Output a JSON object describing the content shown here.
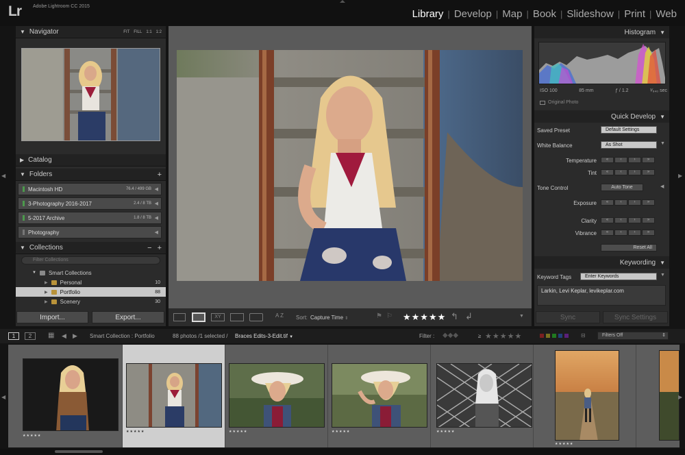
{
  "app": {
    "logo": "Lr",
    "title": "Adobe Lightroom CC 2015"
  },
  "modules": [
    {
      "label": "Library",
      "active": true
    },
    {
      "label": "Develop"
    },
    {
      "label": "Map"
    },
    {
      "label": "Book"
    },
    {
      "label": "Slideshow"
    },
    {
      "label": "Print"
    },
    {
      "label": "Web"
    }
  ],
  "navigator": {
    "title": "Navigator",
    "opts": [
      "FIT",
      "FILL",
      "1:1",
      "1:2"
    ]
  },
  "catalog": {
    "title": "Catalog"
  },
  "folders": {
    "title": "Folders",
    "add": "+",
    "volumes": [
      {
        "name": "Macintosh HD",
        "size": "76.4 / 499 GB"
      },
      {
        "name": "3-Photography 2016-2017",
        "size": "2.4 / 8 TB"
      },
      {
        "name": "5-2017 Archive",
        "size": "1.8 / 8 TB"
      },
      {
        "name": "Photography",
        "size": ""
      }
    ]
  },
  "collections": {
    "title": "Collections",
    "minus": "−",
    "plus": "+",
    "filter_placeholder": "Filter Collections",
    "smart": "Smart Collections",
    "items": [
      {
        "name": "Personal",
        "count": "10"
      },
      {
        "name": "Portfolio",
        "count": "88",
        "selected": true
      },
      {
        "name": "Scenery",
        "count": "30"
      }
    ]
  },
  "left_buttons": {
    "import": "Import...",
    "export": "Export..."
  },
  "toolbar": {
    "sort_label": "Sort:",
    "sort_value": "Capture Time",
    "rating": "★★★★★",
    "az": "A Z"
  },
  "histogram": {
    "title": "Histogram",
    "iso": "ISO 100",
    "focal": "85 mm",
    "aperture": "ƒ / 1.2",
    "shutter": "¹⁄₆₄₀ sec",
    "original": "Original Photo"
  },
  "quick_develop": {
    "title": "Quick Develop",
    "saved_preset_label": "Saved Preset",
    "saved_preset": "Default Settings",
    "wb_label": "White Balance",
    "wb": "As Shot",
    "temperature": "Temperature",
    "tint": "Tint",
    "tone_label": "Tone Control",
    "auto_tone": "Auto Tone",
    "exposure": "Exposure",
    "clarity": "Clarity",
    "vibrance": "Vibrance",
    "reset": "Reset All"
  },
  "keywording": {
    "title": "Keywording",
    "tags_label": "Keyword Tags",
    "tags_value": "Enter Keywords",
    "keywords": "Larkin, Levi Keplar, levikeplar.com"
  },
  "sync": {
    "sync": "Sync",
    "sync_settings": "Sync Settings"
  },
  "filmstrip_bar": {
    "view1": "1",
    "view2": "2",
    "source": "Smart Collection : Portfolio",
    "count": "88 photos /1 selected /",
    "file": "Braces Edits-3-Edit.tif",
    "filter_label": "Filter :",
    "filters_off": "Filters Off",
    "rating_ge": "≥",
    "stars": "★★★★★"
  },
  "film_stars": "★★★★★",
  "colors": {
    "accent": "#c8c8c8",
    "folder_ok": "#4c9a4c",
    "collection_icon": "#b9933a"
  }
}
